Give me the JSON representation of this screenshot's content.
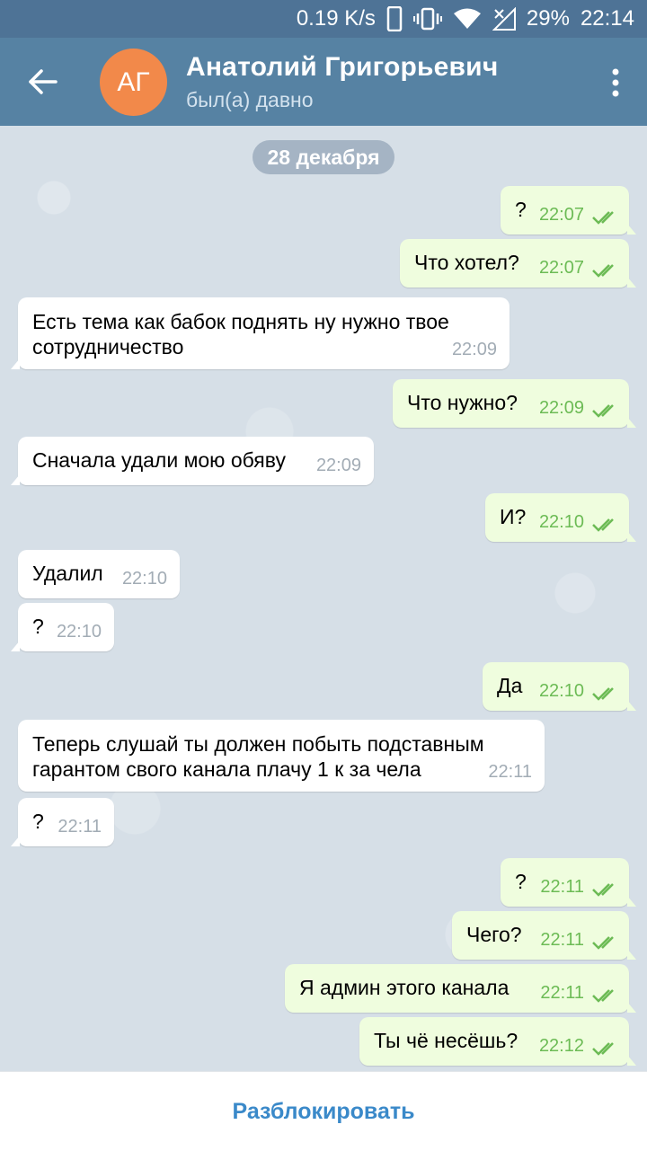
{
  "status_bar": {
    "speed": "0.19 K/s",
    "battery": "29%",
    "time": "22:14"
  },
  "header": {
    "avatar_initials": "АГ",
    "name": "Анатолий Григорьевич",
    "status": "был(а) давно"
  },
  "chat": {
    "date": "28 декабря",
    "messages": [
      {
        "dir": "out",
        "text": "?",
        "time": "22:07"
      },
      {
        "dir": "out",
        "text": "Что хотел?",
        "time": "22:07"
      },
      {
        "dir": "in",
        "text": "Есть тема как бабок поднять ну  нужно твое сотрудничество",
        "time": "22:09"
      },
      {
        "dir": "out",
        "text": "Что нужно?",
        "time": "22:09"
      },
      {
        "dir": "in",
        "text": "Сначала удали мою обяву",
        "time": "22:09"
      },
      {
        "dir": "out",
        "text": "И?",
        "time": "22:10"
      },
      {
        "dir": "in",
        "text": "Удалил",
        "time": "22:10"
      },
      {
        "dir": "in",
        "text": "?",
        "time": "22:10"
      },
      {
        "dir": "out",
        "text": "Да",
        "time": "22:10"
      },
      {
        "dir": "in",
        "text": "Теперь слушай ты должен побыть подставным гарантом свого канала плачу 1 к за чела",
        "time": "22:11"
      },
      {
        "dir": "in",
        "text": "?",
        "time": "22:11"
      },
      {
        "dir": "out",
        "text": "?",
        "time": "22:11"
      },
      {
        "dir": "out",
        "text": "Чего?",
        "time": "22:11"
      },
      {
        "dir": "out",
        "text": "Я админ этого канала",
        "time": "22:11"
      },
      {
        "dir": "out",
        "text": "Ты чё несёшь?",
        "time": "22:12"
      }
    ]
  },
  "bottom": {
    "unblock_label": "Разблокировать"
  },
  "colors": {
    "header": "#5682a3",
    "status_bar": "#4e7396",
    "outgoing": "#effdde",
    "incoming": "#ffffff",
    "check": "#6cbb55",
    "accent": "#3a89c9"
  }
}
